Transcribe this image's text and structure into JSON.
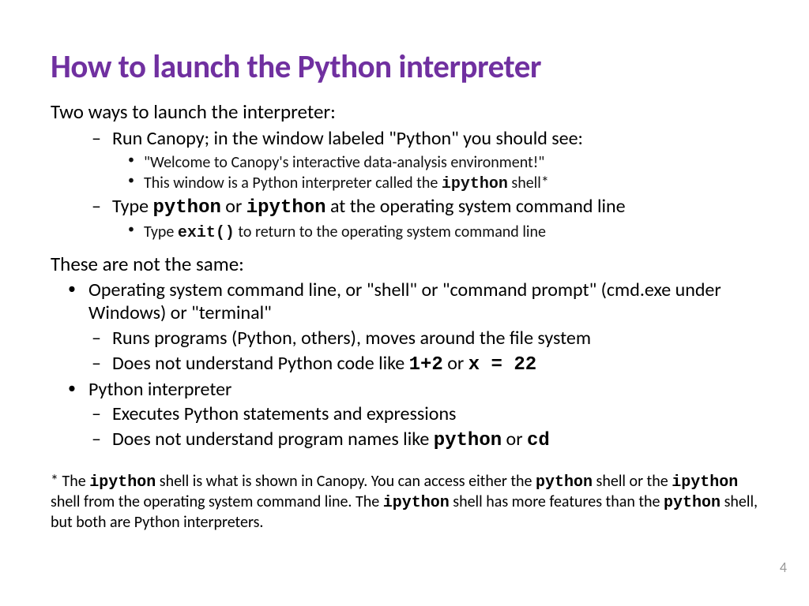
{
  "title": "How to launch the Python interpreter",
  "intro1": "Two ways to launch the interpreter:",
  "ways": [
    {
      "pre": "Run Canopy; in the window labeled \"Python\" you should see:",
      "sub": [
        {
          "text": "\"Welcome to Canopy's interactive data-analysis environment!\""
        },
        {
          "pre": "This window is a Python interpreter called the ",
          "code1": "ipython",
          "post": " shell*"
        }
      ]
    },
    {
      "pre": "Type ",
      "code1": "python",
      "mid": " or ",
      "code2": "ipython",
      "post": "  at the operating system command line",
      "sub": [
        {
          "pre": "Type ",
          "code1": "exit()",
          "post": "  to return to the operating system command line"
        }
      ]
    }
  ],
  "intro2": "These are not the same:",
  "diffs": [
    {
      "text": "Operating system command line, or \"shell\" or \"command prompt\" (cmd.exe under Windows) or \"terminal\"",
      "sub": [
        {
          "text": "Runs programs (Python, others), moves around the file system"
        },
        {
          "pre": "Does not understand Python code like ",
          "code1": "1+2",
          "mid": "  or ",
          "code2": " x = 22"
        }
      ]
    },
    {
      "text": "Python interpreter",
      "sub": [
        {
          "text": "Executes Python statements and expressions"
        },
        {
          "pre": "Does not understand program names like  ",
          "code1": "python",
          "mid": "  or  ",
          "code2": "cd"
        }
      ]
    }
  ],
  "footnote": {
    "p1": "* The ",
    "c1": "ipython",
    "p2": "  shell is what is shown in Canopy.  You can access either the ",
    "c2": "python",
    "p3": " shell or the ",
    "c3": "ipython",
    "p4": " shell from the operating system command line. The ",
    "c4": "ipython",
    "p5": " shell has more features than the ",
    "c5": "python",
    "p6": " shell, but both are Python interpreters."
  },
  "pageNumber": "4"
}
